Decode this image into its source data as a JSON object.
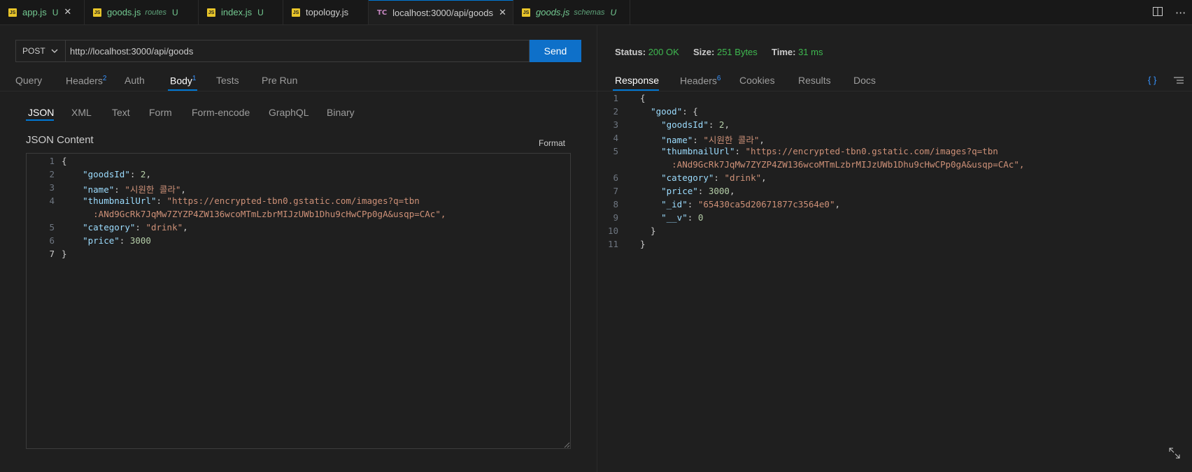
{
  "tabs": [
    {
      "name": "app.js",
      "desc": "",
      "badge": "U",
      "modified": true,
      "italic": false,
      "close": true,
      "icon": "js-icon"
    },
    {
      "name": "goods.js",
      "desc": "routes",
      "badge": "U",
      "modified": true,
      "italic": false,
      "close": false,
      "icon": "js-icon"
    },
    {
      "name": "index.js",
      "desc": "",
      "badge": "U",
      "modified": true,
      "italic": false,
      "close": false,
      "icon": "js-icon"
    },
    {
      "name": "topology.js",
      "desc": "",
      "badge": "",
      "modified": false,
      "italic": false,
      "close": false,
      "icon": "js-icon"
    },
    {
      "name": "localhost:3000/api/goods",
      "desc": "",
      "badge": "",
      "modified": false,
      "italic": false,
      "close": true,
      "icon": "tc-icon",
      "active": true
    },
    {
      "name": "goods.js",
      "desc": "schemas",
      "badge": "U",
      "modified": true,
      "italic": true,
      "close": false,
      "icon": "js-icon"
    }
  ],
  "js_icon_text": "JS",
  "tc_icon_text": "TC",
  "close_glyph": "✕",
  "request": {
    "method": "POST",
    "url": "http://localhost:3000/api/goods",
    "send_label": "Send",
    "tabs": [
      {
        "label": "Query",
        "count": ""
      },
      {
        "label": "Headers",
        "count": "2"
      },
      {
        "label": "Auth",
        "count": ""
      },
      {
        "label": "Body",
        "count": "1",
        "active": true
      },
      {
        "label": "Tests",
        "count": ""
      },
      {
        "label": "Pre Run",
        "count": ""
      }
    ],
    "body_tabs": [
      "JSON",
      "XML",
      "Text",
      "Form",
      "Form-encode",
      "GraphQL",
      "Binary"
    ],
    "active_body_tab": "JSON",
    "json_content_label": "JSON Content",
    "format_label": "Format",
    "body_lines": [
      {
        "n": "1",
        "text": "{"
      },
      {
        "n": "2",
        "text": "    \"goodsId\": 2,"
      },
      {
        "n": "3",
        "text": "    \"name\": \"시원한 콜라\","
      },
      {
        "n": "4",
        "text": "    \"thumbnailUrl\": \"https://encrypted-tbn0.gstatic.com/images?q=tbn"
      },
      {
        "n": "",
        "text": "      :ANd9GcRk7JqMw7ZYZP4ZW136wcoMTmLzbrMIJzUWb1Dhu9cHwCPp0gA&usqp=CAc\","
      },
      {
        "n": "5",
        "text": "    \"category\": \"drink\","
      },
      {
        "n": "6",
        "text": "    \"price\": 3000"
      },
      {
        "n": "7",
        "text": "}"
      }
    ]
  },
  "response": {
    "status_label": "Status:",
    "status": "200 OK",
    "size_label": "Size:",
    "size": "251 Bytes",
    "time_label": "Time:",
    "time": "31 ms",
    "tabs": [
      {
        "label": "Response",
        "count": "",
        "active": true
      },
      {
        "label": "Headers",
        "count": "6"
      },
      {
        "label": "Cookies",
        "count": ""
      },
      {
        "label": "Results",
        "count": ""
      },
      {
        "label": "Docs",
        "count": ""
      }
    ],
    "braces_label": "{ }",
    "lines": [
      {
        "n": "1",
        "text": "{"
      },
      {
        "n": "2",
        "text": "  \"good\": {"
      },
      {
        "n": "3",
        "text": "    \"goodsId\": 2,"
      },
      {
        "n": "4",
        "text": "    \"name\": \"시원한 콜라\","
      },
      {
        "n": "5",
        "text": "    \"thumbnailUrl\": \"https://encrypted-tbn0.gstatic.com/images?q=tbn"
      },
      {
        "n": "",
        "text": "      :ANd9GcRk7JqMw7ZYZP4ZW136wcoMTmLzbrMIJzUWb1Dhu9cHwCPp0gA&usqp=CAc\","
      },
      {
        "n": "6",
        "text": "    \"category\": \"drink\","
      },
      {
        "n": "7",
        "text": "    \"price\": 3000,"
      },
      {
        "n": "8",
        "text": "    \"_id\": \"65430ca5d20671877c3564e0\","
      },
      {
        "n": "9",
        "text": "    \"__v\": 0"
      },
      {
        "n": "10",
        "text": "  }"
      },
      {
        "n": "11",
        "text": "}"
      }
    ]
  },
  "colors": {
    "accent": "#0078d4",
    "send": "#0e70c9",
    "success": "#3fb950",
    "modified": "#73c991",
    "key": "#9cdcfe",
    "string": "#ce9178",
    "number": "#b5cea8"
  }
}
